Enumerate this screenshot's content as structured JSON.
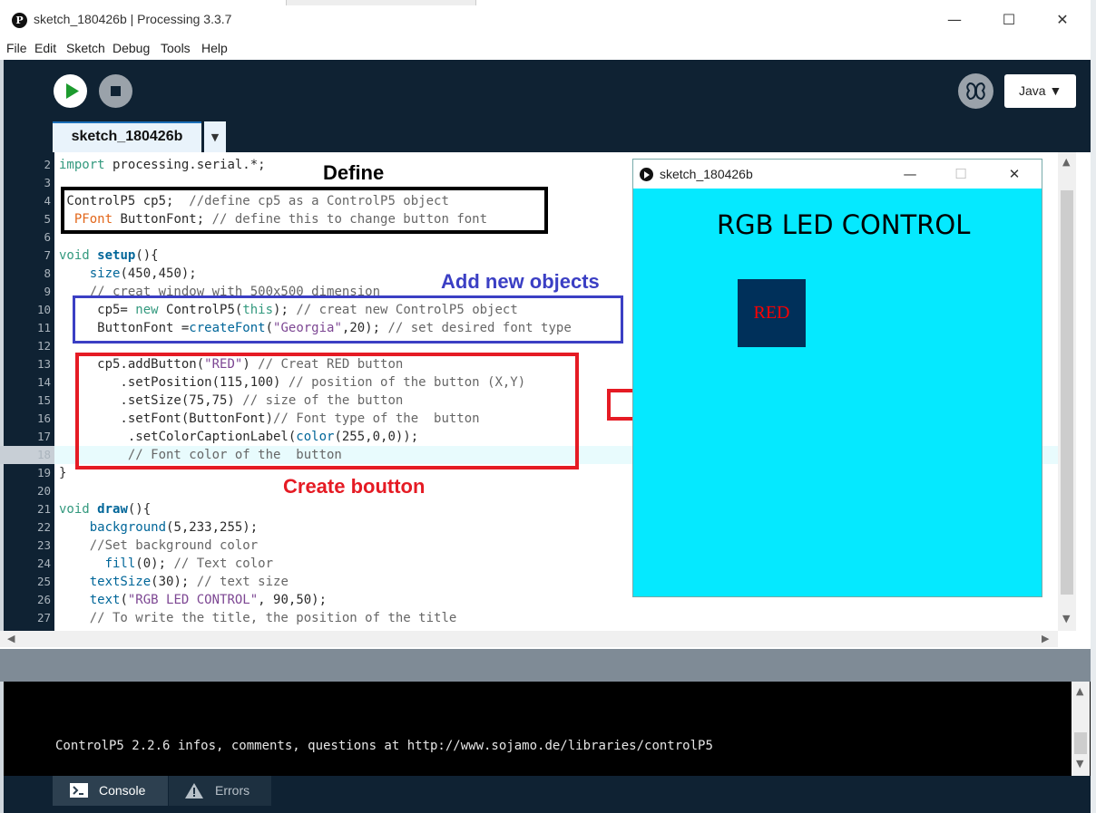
{
  "window": {
    "title": "sketch_180426b | Processing 3.3.7",
    "minimize": "—",
    "maximize": "☐",
    "close": "✕"
  },
  "menu": [
    "File",
    "Edit",
    "Sketch",
    "Debug",
    "Tools",
    "Help"
  ],
  "toolbar": {
    "mode_label": "Java ▼"
  },
  "tabs": {
    "active": "sketch_180426b",
    "arrow": "▼"
  },
  "editor": {
    "lines": [
      {
        "n": "2",
        "text": "import processing.serial.*;"
      },
      {
        "n": "3",
        "text": ""
      },
      {
        "n": "4",
        "text": " ControlP5 cp5;  //define cp5 as a ControlP5 object"
      },
      {
        "n": "5",
        "text": "  PFont ButtonFont; // define this to change button font"
      },
      {
        "n": "6",
        "text": ""
      },
      {
        "n": "7",
        "text": "void setup(){"
      },
      {
        "n": "8",
        "text": "    size(450,450);"
      },
      {
        "n": "9",
        "text": "    // creat window with 500x500 dimension"
      },
      {
        "n": "10",
        "text": "     cp5= new ControlP5(this); // creat new ControlP5 object"
      },
      {
        "n": "11",
        "text": "     ButtonFont =createFont(\"Georgia\",20); // set desired font type"
      },
      {
        "n": "12",
        "text": ""
      },
      {
        "n": "13",
        "text": "     cp5.addButton(\"RED\") // Creat RED button"
      },
      {
        "n": "14",
        "text": "        .setPosition(115,100) // position of the button (X,Y)"
      },
      {
        "n": "15",
        "text": "        .setSize(75,75) // size of the button"
      },
      {
        "n": "16",
        "text": "        .setFont(ButtonFont)// Font type of the  button"
      },
      {
        "n": "17",
        "text": "         .setColorCaptionLabel(color(255,0,0));"
      },
      {
        "n": "18",
        "text": "         // Font color of the  button"
      },
      {
        "n": "19",
        "text": "}"
      },
      {
        "n": "20",
        "text": ""
      },
      {
        "n": "21",
        "text": "void draw(){"
      },
      {
        "n": "22",
        "text": "    background(5,233,255);"
      },
      {
        "n": "23",
        "text": "    //Set background color"
      },
      {
        "n": "24",
        "text": "      fill(0); // Text color"
      },
      {
        "n": "25",
        "text": "    textSize(30); // text size"
      },
      {
        "n": "26",
        "text": "    text(\"RGB LED CONTROL\", 90,50);"
      },
      {
        "n": "27",
        "text": "    // To write the title, the position of the title"
      }
    ]
  },
  "annotations": {
    "define": "Define",
    "add_objects": "Add new objects",
    "create_button": "Create boutton"
  },
  "sketch": {
    "title": "sketch_180426b",
    "minimize": "—",
    "maximize": "☐",
    "close": "✕",
    "heading": "RGB LED CONTROL",
    "button_label": "RED"
  },
  "console": {
    "text": "ControlP5 2.2.6 infos, comments, questions at http://www.sojamo.de/libraries/controlP5"
  },
  "bottom_tabs": {
    "console": "Console",
    "errors": "Errors"
  },
  "colors": {
    "sketch_bg": "#05e9ff",
    "button_bg": "#00305a",
    "button_text": "#ff0000",
    "ann_black": "#000000",
    "ann_blue": "#3b3fc4",
    "ann_red": "#e51b24"
  }
}
